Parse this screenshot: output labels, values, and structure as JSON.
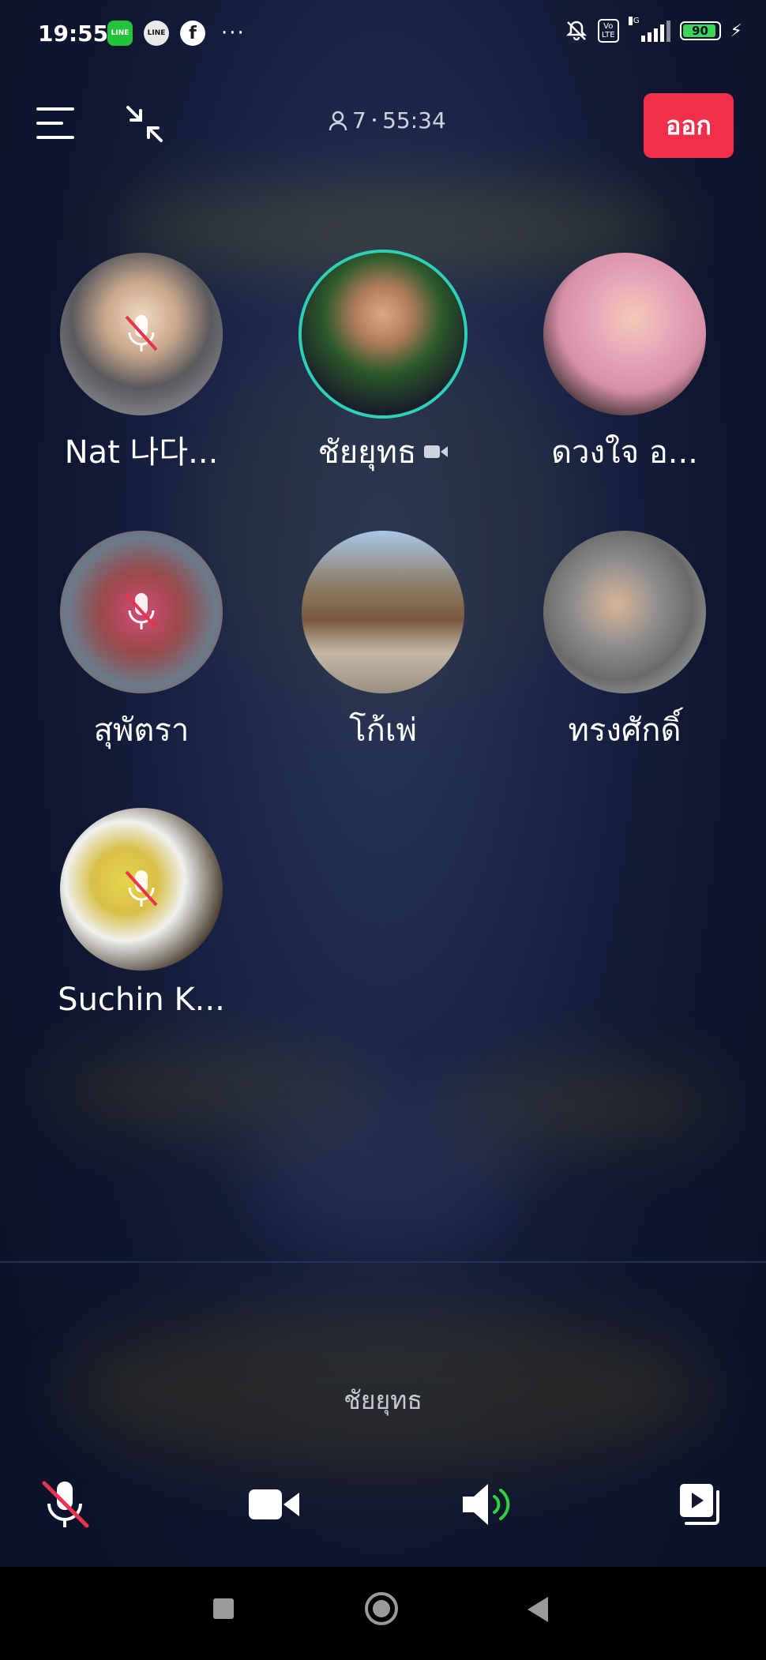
{
  "status_bar": {
    "time": "19:55",
    "app_icons": [
      "LINE",
      "LINE",
      "f"
    ],
    "more": "···",
    "volte": "Vo\nLTE",
    "network": "4G",
    "battery": "90"
  },
  "topbar": {
    "participant_count": "7",
    "separator": "•",
    "duration": "55:34",
    "leave_label": "ออก"
  },
  "participants": [
    {
      "name": "Nat 나다...",
      "muted": true
    },
    {
      "name": "ชัยยุทธ",
      "muted": false,
      "speaking": true,
      "video": true
    },
    {
      "name": "ดวงใจ อ...",
      "muted": false
    },
    {
      "name": "สุพัตรา",
      "muted": true
    },
    {
      "name": "โก้เพ่",
      "muted": false
    },
    {
      "name": "ทรงศักดิ์",
      "muted": false
    },
    {
      "name": "Suchin K...",
      "muted": true
    }
  ],
  "speaking": {
    "name": "ชัยยุทธ"
  },
  "colors": {
    "leave": "#f0304b",
    "speaking_ring": "#2fd1b6",
    "mute_slash": "#e8334f",
    "speaker_wave": "#2fd13e"
  },
  "controls": [
    "mic-muted-icon",
    "video-camera-icon",
    "speaker-icon",
    "screen-share-icon"
  ]
}
